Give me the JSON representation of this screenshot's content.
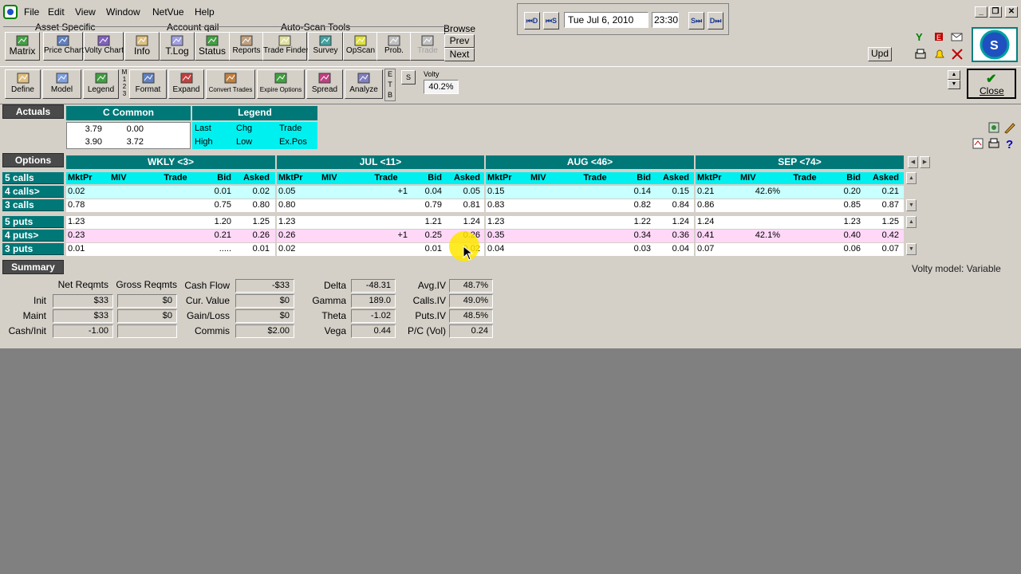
{
  "menu": [
    "File",
    "Edit",
    "View",
    "Window",
    "NetVue",
    "Help"
  ],
  "datebar": {
    "btn_md": "M",
    "btn_md_sub": "D",
    "btn_ms": "M",
    "btn_ms_sub": "S",
    "date": "Tue Jul 6, 2010",
    "time": "23:30",
    "btn_s": "S",
    "btn_d": "D"
  },
  "toolbar1": {
    "asset_label": "Asset Specific",
    "account_label": "Account qail",
    "autoscan_label": "Auto-Scan Tools",
    "browse_label": "Browse",
    "prev": "Prev",
    "next": "Next",
    "upd": "Upd",
    "buttons": [
      {
        "label": "Matrix",
        "icon": "matrix-icon"
      },
      {
        "label": "Price Chart",
        "icon": "price-chart-icon"
      },
      {
        "label": "Volty Chart",
        "icon": "volty-chart-icon"
      },
      {
        "label": "Info",
        "icon": "info-icon"
      },
      {
        "label": "T.Log",
        "icon": "tlog-icon"
      },
      {
        "label": "Status",
        "icon": "status-icon"
      },
      {
        "label": "Reports",
        "icon": "reports-icon"
      },
      {
        "label": "Trade Finder",
        "icon": "trade-finder-icon"
      },
      {
        "label": "Survey",
        "icon": "survey-icon"
      },
      {
        "label": "OpScan",
        "icon": "opscan-icon"
      },
      {
        "label": "Prob.",
        "icon": "prob-icon"
      },
      {
        "label": "Trade",
        "icon": "trade-icon"
      }
    ]
  },
  "toolbar2": {
    "buttons": [
      {
        "label": "Define",
        "icon": "define-icon"
      },
      {
        "label": "Model",
        "icon": "model-icon"
      },
      {
        "label": "Legend",
        "icon": "legend-icon"
      },
      {
        "label": "Format",
        "icon": "format-icon"
      },
      {
        "label": "Expand",
        "icon": "expand-icon"
      },
      {
        "label": "Convert Trades",
        "icon": "convert-trades-icon"
      },
      {
        "label": "Expire Options",
        "icon": "expire-options-icon"
      },
      {
        "label": "Spread",
        "icon": "spread-icon"
      },
      {
        "label": "Analyze",
        "icon": "analyze-icon"
      }
    ],
    "m_stack": [
      "M",
      "1",
      "2",
      "3"
    ],
    "etb_stack": [
      "E",
      "T",
      "B"
    ],
    "s_label": "S",
    "volty_label": "Volty",
    "volty_value": "40.2%",
    "close_label": "Close"
  },
  "actuals": {
    "header": "Actuals",
    "common_header": "C Common",
    "legend_header": "Legend",
    "values": [
      [
        "3.79",
        "0.00"
      ],
      [
        "3.90",
        "3.72"
      ]
    ],
    "legend_row1": [
      "Last",
      "Chg",
      "Trade"
    ],
    "legend_row2": [
      "High",
      "Low",
      "Ex.Pos"
    ]
  },
  "options": {
    "header": "Options",
    "months": [
      "WKLY <3>",
      "JUL <11>",
      "AUG <46>",
      "SEP <74>"
    ],
    "columns": [
      "MktPr",
      "MIV",
      "Trade",
      "Bid",
      "Asked"
    ],
    "rows": [
      {
        "label": "5 calls",
        "color": "c-white",
        "cells": [
          [
            "",
            "",
            "",
            "",
            ""
          ],
          [
            "",
            "",
            "",
            "",
            ""
          ],
          [
            "",
            "",
            "",
            "",
            ""
          ],
          [
            "",
            "",
            "",
            "",
            ""
          ]
        ]
      },
      {
        "label": "4 calls>",
        "color": "c-cyan",
        "cells": [
          [
            "0.02",
            "",
            "",
            "0.01",
            "0.02"
          ],
          [
            "0.05",
            "",
            "+1",
            "0.04",
            "0.05"
          ],
          [
            "0.15",
            "",
            "",
            "0.14",
            "0.15"
          ],
          [
            "0.21",
            "42.6%",
            "",
            "0.20",
            "0.21"
          ]
        ]
      },
      {
        "label": "3 calls",
        "color": "c-white",
        "cells": [
          [
            "0.78",
            "",
            "",
            "0.75",
            "0.80"
          ],
          [
            "0.80",
            "",
            "",
            "0.79",
            "0.81"
          ],
          [
            "0.83",
            "",
            "",
            "0.82",
            "0.84"
          ],
          [
            "0.86",
            "",
            "",
            "0.85",
            "0.87"
          ]
        ]
      },
      {
        "label": "5 puts",
        "color": "c-white",
        "cells": [
          [
            "1.23",
            "",
            "",
            "1.20",
            "1.25"
          ],
          [
            "1.23",
            "",
            "",
            "1.21",
            "1.24"
          ],
          [
            "1.23",
            "",
            "",
            "1.22",
            "1.24"
          ],
          [
            "1.24",
            "",
            "",
            "1.23",
            "1.25"
          ]
        ]
      },
      {
        "label": "4 puts>",
        "color": "c-pink",
        "cells": [
          [
            "0.23",
            "",
            "",
            "0.21",
            "0.26"
          ],
          [
            "0.26",
            "",
            "+1",
            "0.25",
            "0.26"
          ],
          [
            "0.35",
            "",
            "",
            "0.34",
            "0.36"
          ],
          [
            "0.41",
            "42.1%",
            "",
            "0.40",
            "0.42"
          ]
        ]
      },
      {
        "label": "3 puts",
        "color": "c-white",
        "cells": [
          [
            "0.01",
            "",
            "",
            ".....",
            "0.01"
          ],
          [
            "0.02",
            "",
            "",
            "0.01",
            "0.02"
          ],
          [
            "0.04",
            "",
            "",
            "0.03",
            "0.04"
          ],
          [
            "0.07",
            "",
            "",
            "0.06",
            "0.07"
          ]
        ]
      }
    ],
    "volty_model": "Volty model: Variable"
  },
  "summary": {
    "header": "Summary",
    "net_reqmts": "Net Reqmts",
    "gross_reqmts": "Gross Reqmts",
    "reqmts": [
      {
        "label": "Init",
        "net": "$33",
        "gross": "$0"
      },
      {
        "label": "Maint",
        "net": "$33",
        "gross": "$0"
      },
      {
        "label": "Cash/Init",
        "net": "-1.00",
        "gross": ""
      }
    ],
    "cash": [
      {
        "label": "Cash Flow",
        "value": "-$33"
      },
      {
        "label": "Cur. Value",
        "value": "$0"
      },
      {
        "label": "Gain/Loss",
        "value": "$0"
      },
      {
        "label": "Commis",
        "value": "$2.00"
      }
    ],
    "greeks": [
      {
        "label": "Delta",
        "value": "-48.31"
      },
      {
        "label": "Gamma",
        "value": "189.0"
      },
      {
        "label": "Theta",
        "value": "-1.02"
      },
      {
        "label": "Vega",
        "value": "0.44"
      }
    ],
    "iv": [
      {
        "label": "Avg.IV",
        "value": "48.7%"
      },
      {
        "label": "Calls.IV",
        "value": "49.0%"
      },
      {
        "label": "Puts.IV",
        "value": "48.5%"
      },
      {
        "label": "P/C (Vol)",
        "value": "0.24"
      }
    ]
  }
}
